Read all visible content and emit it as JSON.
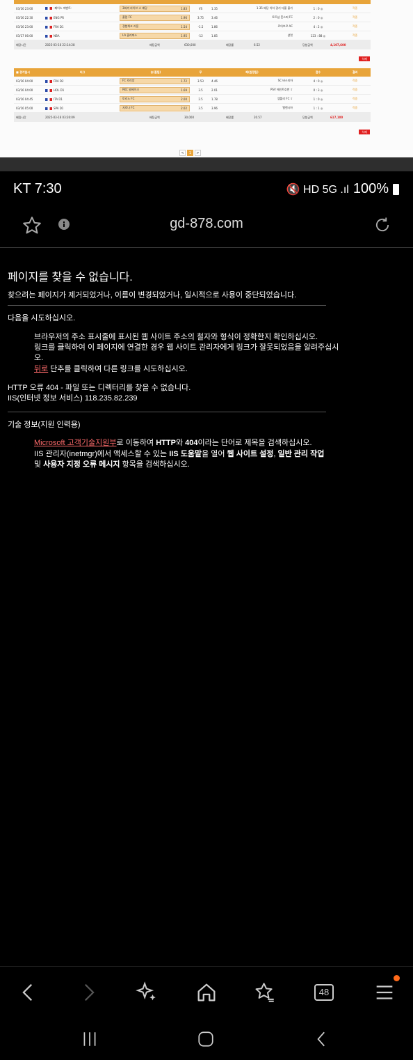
{
  "screenshot": {
    "t1": {
      "header": [
        "",
        "",
        "",
        "",
        "",
        "",
        ""
      ],
      "rows": [
        {
          "date": "03/16 23:00",
          "league": "-페이스 에벤트-",
          "home": "3회까 라이브 스 배당",
          "hodd": "1.83",
          "x": "VS",
          "aodd": "1.35",
          "away": "1.35 배당 이하 경기 다폴 불가",
          "score": "1 : 0 ◎",
          "res": "적중"
        },
        {
          "date": "03/16 22:30",
          "league": "ENG PR",
          "home": "풀럼 FC",
          "hodd": "1.96",
          "x": "3.75",
          "aodd": "3.46",
          "away": "토트넘 홋스퍼 FC",
          "score": "2 : 0 ◎",
          "res": "적중"
        },
        {
          "date": "03/16 23:00",
          "league": "FRA D1",
          "home": "경험체크 리옹",
          "hodd": "1.54",
          "x": "-1.5",
          "aodd": "1.86",
          "away": "르아브르 AC",
          "score": "4 : 2 ◎",
          "res": "적중"
        },
        {
          "date": "03/17 06:00",
          "league": "NBA",
          "home": "LA 클리퍼스",
          "hodd": "1.95",
          "x": "-12",
          "aodd": "1.85",
          "away": "샬럿",
          "score": "123 : 88 ◎",
          "res": "적중"
        }
      ],
      "footer": {
        "a": "배당시간",
        "b": "2025-03-16 22:14:28",
        "c": "배팅금액",
        "d": "630,000",
        "e": "배당률",
        "f": "6.52",
        "g": "당첨금액",
        "h": "4,107,600"
      }
    },
    "t2": {
      "header": [
        "■ 경기일시",
        "리그",
        "승(홈팀)",
        "무",
        "패(원정팀)",
        "점수",
        "결과"
      ],
      "rows": [
        {
          "date": "03/16 04:00",
          "league": "FRA D2",
          "home": "FC 로리앙",
          "hodd": "1.72",
          "x": "3.53",
          "aodd": "4.46",
          "away": "SC 바스티아",
          "score": "4 : 0 ◎",
          "res": "적중"
        },
        {
          "date": "03/16 04:00",
          "league": "HOL D1",
          "home": "RKC 발베이크",
          "hodd": "1.69",
          "x": "3.5",
          "aodd": "2.01",
          "away": "PSV 에인트호번 ⇧",
          "score": "0 : 3 ◎",
          "res": "적중"
        },
        {
          "date": "03/16 04:45",
          "league": "ITA D1",
          "home": "토리노 FC",
          "hodd": "2.00",
          "x": "2.5",
          "aodd": "1.78",
          "away": "엠폴리 FC ⇧",
          "score": "1 : 0 ◎",
          "res": "적중"
        },
        {
          "date": "03/16 05:00",
          "league": "SPA D1",
          "home": "지로나 FC",
          "hodd": "2.02",
          "x": "3.5",
          "aodd": "3.96",
          "away": "엘렌시아",
          "score": "1 : 1 ◎",
          "res": "적중"
        }
      ],
      "footer": {
        "a": "배팅시간",
        "b": "2025-03-16 03:26:09",
        "c": "배팅금액",
        "d": "30,000",
        "e": "배당률",
        "f": "20.57",
        "g": "당첨금액",
        "h": "617,100"
      }
    },
    "delete_label": "삭제",
    "pages": [
      "<",
      "1",
      ">"
    ]
  },
  "status": {
    "time": "KT 7:30",
    "battery": "100%",
    "icons": "🔇 HD 5G .ıl"
  },
  "browser": {
    "url": "gd-878.com"
  },
  "error": {
    "title": "페이지를 찾을 수 없습니다.",
    "subtitle": "찾으려는 페이지가 제거되었거나, 이름이 변경되었거나, 일시적으로 사용이 중단되었습니다.",
    "try_label": "다음을 시도하십시오.",
    "b1": "브라우저의 주소 표시줄에 표시된 웹 사이트 주소의 철자와 형식이 정확한지 확인하십시오.",
    "b2": "링크를 클릭하여 이 페이지에 연결한 경우 웹 사이트 관리자에게 링크가 잘못되었음을 알려주십시오.",
    "back_link": "뒤로",
    "b3_rest": " 단추를 클릭하여 다른 링크를 시도하십시오.",
    "http1": "HTTP 오류 404 - 파일 또는 디렉터리를 찾을 수 없습니다.",
    "http2": "IIS(인터넷 정보 서비스) 118.235.82.239",
    "tech": "기술 정보(지원 인력용)",
    "ms_link": "Microsoft 고객기술지원부",
    "t1a": "로 이동하여 ",
    "t1b": "HTTP",
    "t1c": "와 ",
    "t1d": "404",
    "t1e": "이라는 단어로 제목을 검색하십시오.",
    "t2a": "IIS 관리자(inetmgr)에서 액세스할 수 있는 ",
    "t2b": "IIS 도움말",
    "t2c": "을 열어 ",
    "t2d": "웹 사이트 설정",
    "t2e": ", ",
    "t2f": "일반 관리 작업",
    "t3a": "및 ",
    "t3b": "사용자 지정 오류 메시지",
    "t3c": " 항목을 검색하십시오."
  },
  "navbar": {
    "tabs_count": "48"
  },
  "icons": [
    "star-icon",
    "info-icon",
    "reload-icon",
    "back-icon",
    "forward-icon",
    "sparkle-icon",
    "home-icon",
    "bookmarks-icon",
    "tabs-icon",
    "menu-icon"
  ]
}
